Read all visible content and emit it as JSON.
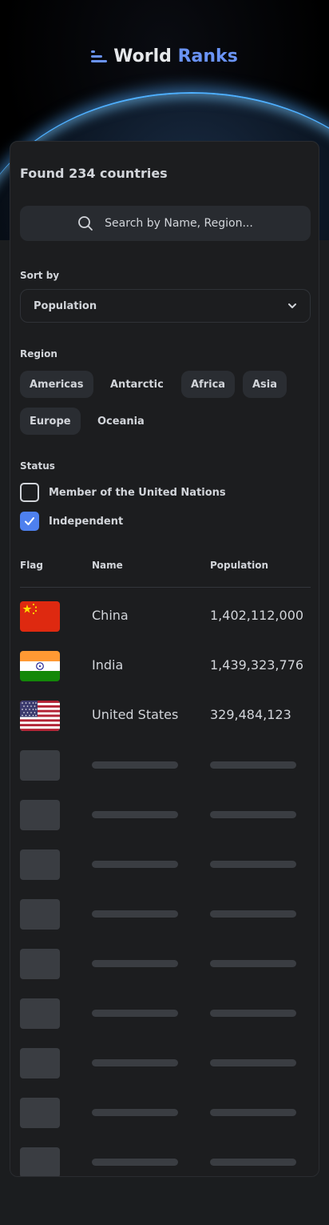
{
  "header": {
    "logo_word1": "World",
    "logo_word2": "Ranks",
    "accent": "#6a93f5"
  },
  "summary": {
    "found_text": "Found 234 countries"
  },
  "search": {
    "placeholder": "Search by Name, Region..."
  },
  "sort": {
    "label": "Sort by",
    "selected": "Population"
  },
  "region": {
    "label": "Region",
    "chips": [
      {
        "label": "Americas",
        "active": true
      },
      {
        "label": "Antarctic",
        "active": false
      },
      {
        "label": "Africa",
        "active": true
      },
      {
        "label": "Asia",
        "active": true
      },
      {
        "label": "Europe",
        "active": true
      },
      {
        "label": "Oceania",
        "active": false
      }
    ]
  },
  "status": {
    "label": "Status",
    "options": [
      {
        "label": "Member of the United Nations",
        "checked": false
      },
      {
        "label": "Independent",
        "checked": true
      }
    ]
  },
  "table": {
    "headers": {
      "flag": "Flag",
      "name": "Name",
      "population": "Population"
    },
    "rows": [
      {
        "flag": "china-flag-icon",
        "name": "China",
        "population": "1,402,112,000"
      },
      {
        "flag": "india-flag-icon",
        "name": "India",
        "population": "1,439,323,776"
      },
      {
        "flag": "usa-flag-icon",
        "name": "United States",
        "population": "329,484,123"
      }
    ]
  },
  "colors": {
    "page_bg": "#1b1d1f",
    "card_bg": "#1c1d1f",
    "chip_active": "#2a2d32",
    "checkbox_on": "#4e80ee",
    "skeleton": "#3a3d42"
  }
}
